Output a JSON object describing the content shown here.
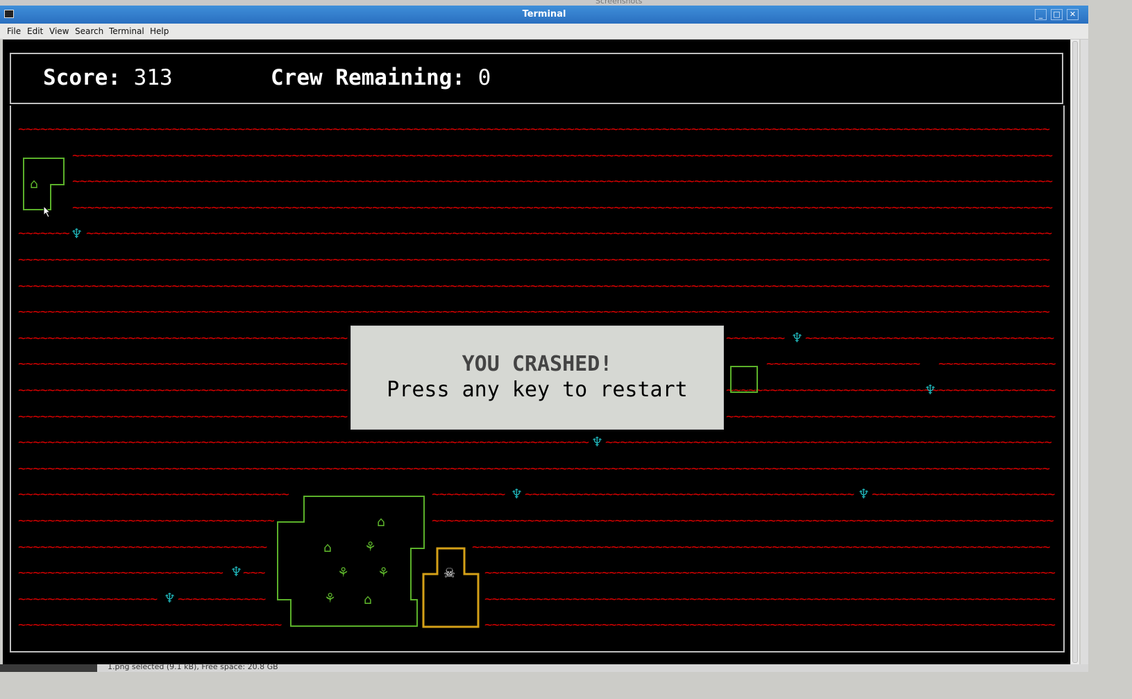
{
  "window": {
    "behind_title": "Screenshots",
    "title": "Terminal",
    "buttons": [
      "_",
      "□",
      "✕"
    ]
  },
  "menu": [
    "File",
    "Edit",
    "View",
    "Search",
    "Terminal",
    "Help"
  ],
  "hud": {
    "score_label": "Score:",
    "score_value": "313",
    "crew_label": "Crew Remaining:",
    "crew_value": "0"
  },
  "dialog": {
    "title": "YOU CRASHED!",
    "message": "Press any key to restart"
  },
  "statusbar": {
    "text": "1.png  selected (9.1 kB), Free space: 20.8 GB"
  },
  "glyphs": {
    "wave": "~",
    "anchor": "♆",
    "hut": "⌂",
    "survivor": "⚘",
    "pirate": "☠"
  },
  "colors": {
    "sea": "#d80000",
    "island": "#5bb12a",
    "anchor": "#1fb4b8",
    "player_ship": "#d4a017",
    "pirate": "#ffffff"
  }
}
